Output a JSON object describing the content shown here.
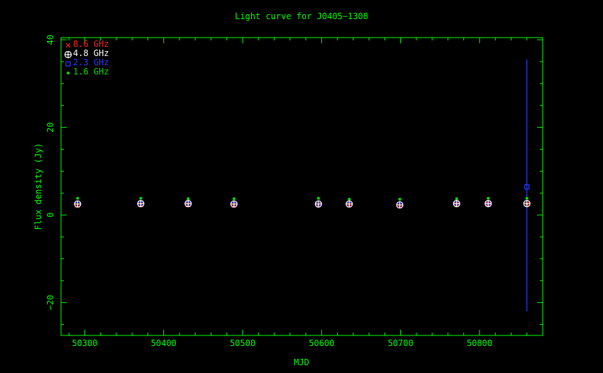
{
  "chart_data": {
    "type": "scatter",
    "title": "Light curve for J0405−1308",
    "xlabel": "MJD",
    "ylabel": "Flux density (Jy)",
    "xlim": [
      50270,
      50880
    ],
    "ylim": [
      -27.5,
      40.5
    ],
    "x_ticks": [
      50300,
      50400,
      50500,
      50600,
      50700,
      50800
    ],
    "y_ticks": [
      -20,
      0,
      20,
      40
    ],
    "legend_position": "top-left",
    "colors": {
      "axes": "#00ff00",
      "text": "#00ff00",
      "background": "#000000"
    },
    "series": [
      {
        "name": "8.6 GHz",
        "marker": "x",
        "color": "#ff2020",
        "x": [
          50291,
          50371,
          50431,
          50489,
          50596,
          50635,
          50699,
          50771,
          50811,
          50860
        ],
        "y": [
          2.2,
          2.3,
          2.3,
          2.2,
          2.3,
          2.3,
          2.0,
          2.4,
          2.5,
          2.5
        ]
      },
      {
        "name": "4.8 GHz",
        "marker": "circle-plus",
        "color": "#ffffff",
        "x": [
          50291,
          50371,
          50431,
          50489,
          50596,
          50635,
          50699,
          50771,
          50811,
          50860
        ],
        "y": [
          2.5,
          2.6,
          2.6,
          2.5,
          2.5,
          2.5,
          2.3,
          2.6,
          2.6,
          2.6
        ]
      },
      {
        "name": "2.3 GHz",
        "marker": "square",
        "color": "#2a3cff",
        "x": [
          50291,
          50371,
          50431,
          50489,
          50596,
          50635,
          50699,
          50771,
          50811,
          50860
        ],
        "y": [
          2.4,
          2.5,
          2.5,
          2.4,
          2.4,
          2.4,
          2.2,
          2.5,
          2.5,
          6.4
        ],
        "yerr_low": [
          null,
          null,
          null,
          null,
          null,
          null,
          null,
          null,
          null,
          -22.0
        ],
        "yerr_high": [
          null,
          null,
          null,
          null,
          null,
          null,
          null,
          null,
          null,
          35.5
        ]
      },
      {
        "name": "1.6 GHz",
        "marker": "dot",
        "color": "#00e000",
        "x": [
          50291,
          50371,
          50431,
          50489,
          50596,
          50635,
          50699,
          50771,
          50811,
          50860
        ],
        "y": [
          3.8,
          3.8,
          3.7,
          3.7,
          3.8,
          3.6,
          3.6,
          3.7,
          3.8,
          3.8
        ]
      }
    ]
  }
}
